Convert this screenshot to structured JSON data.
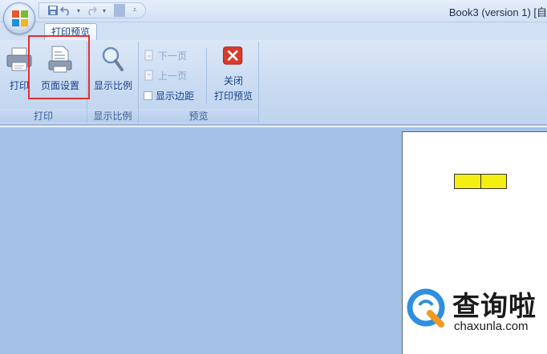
{
  "window": {
    "title": "Book3 (version 1) [自"
  },
  "quick_access": {
    "icons": [
      "save-icon",
      "undo-icon",
      "redo-icon",
      "customize-icon"
    ]
  },
  "tabs": [
    {
      "label": "打印预览",
      "active": true
    }
  ],
  "ribbon": {
    "groups": {
      "print": {
        "label": "打印",
        "print_button": "打印",
        "page_setup_button": "页面设置"
      },
      "zoom": {
        "label": "显示比例",
        "zoom_button": "显示比例"
      },
      "preview": {
        "label": "预览",
        "next_page": "下一页",
        "prev_page": "上一页",
        "show_margins": "显示边距",
        "close_line1": "关闭",
        "close_line2": "打印预览"
      }
    }
  },
  "colors": {
    "highlight": "#e03030",
    "cell_fill": "#f4ee12",
    "ribbon": "#c5d8f0",
    "preview_bg": "#a4c2e8"
  },
  "watermark": {
    "cn": "查询啦",
    "en": "chaxunla.com"
  }
}
